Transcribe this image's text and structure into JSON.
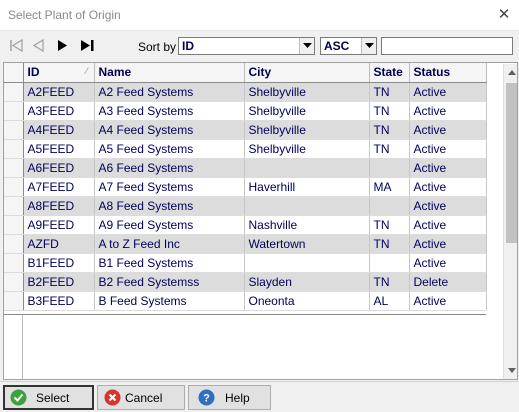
{
  "window": {
    "title": "Select Plant of Origin",
    "close_glyph": "✕"
  },
  "toolbar": {
    "sort_label": "Sort by",
    "sort_field": "ID",
    "sort_order": "ASC",
    "search_value": "",
    "nav_icons": [
      "first-record-icon",
      "previous-record-icon",
      "next-record-icon",
      "last-record-icon"
    ]
  },
  "grid": {
    "sort_indicator": "⁄",
    "columns": [
      "ID",
      "Name",
      "City",
      "State",
      "Status"
    ],
    "rows": [
      [
        "A2FEED",
        "A2 Feed Systems",
        "Shelbyville",
        "TN",
        "Active"
      ],
      [
        "A3FEED",
        "A3 Feed Systems",
        "Shelbyville",
        "TN",
        "Active"
      ],
      [
        "A4FEED",
        "A4 Feed Systems",
        "Shelbyville",
        "TN",
        "Active"
      ],
      [
        "A5FEED",
        "A5 Feed Systems",
        "Shelbyville",
        "TN",
        "Active"
      ],
      [
        "A6FEED",
        "A6 Feed Systems",
        "",
        "",
        "Active"
      ],
      [
        "A7FEED",
        "A7 Feed Systems",
        "Haverhill",
        "MA",
        "Active"
      ],
      [
        "A8FEED",
        "A8 Feed Systems",
        "",
        "",
        "Active"
      ],
      [
        "A9FEED",
        "A9 Feed Systems",
        "Nashville",
        "TN",
        "Active"
      ],
      [
        "AZFD",
        "A to Z Feed Inc",
        "Watertown",
        "TN",
        "Active"
      ],
      [
        "B1FEED",
        "B1 Feed Systems",
        "",
        "",
        "Active"
      ],
      [
        "B2FEED",
        "B2 Feed Systemss",
        "Slayden",
        "TN",
        "Delete"
      ],
      [
        "B3FEED",
        "B Feed Systems",
        "Oneonta",
        "AL",
        "Active"
      ]
    ]
  },
  "buttons": {
    "select_label": "Select",
    "cancel_label": "Cancel",
    "help_label": "Help"
  },
  "colors": {
    "row_alt": "#dcdcdc",
    "cell_text": "#00005a",
    "select_icon": "#3ca23c",
    "cancel_icon": "#d9342b",
    "help_icon": "#2f6fbf"
  }
}
